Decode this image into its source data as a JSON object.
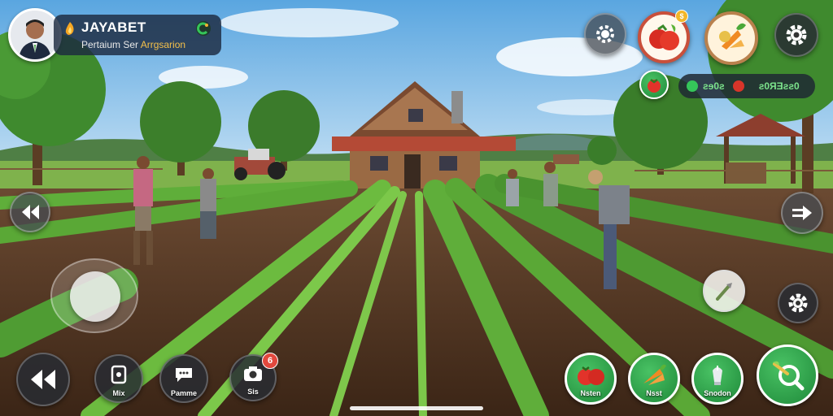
{
  "profile": {
    "title": "JAYABET",
    "subtitle_prefix": "Pertaium Ser ",
    "subtitle_accent": "Arrgsarion",
    "avatar_icon": "player-avatar",
    "brand_icon": "flame-icon",
    "badge_icon": "c-badge-icon"
  },
  "top_buttons": {
    "settings_gear_badge_icon": "gear-badge-icon",
    "tomato_basket_icon": "tomato-icon",
    "vegetables_icon": "vegetables-icon",
    "settings_icon": "gear-icon"
  },
  "stats": {
    "icon_a": "tomato-icon",
    "value_a": "ƨɘ0ƨ",
    "value_b": "ƨ0ЯƎƨƨ0",
    "icon_b": "green-leaf-icon"
  },
  "side_controls": {
    "left_arrow_icon": "double-arrow-left-icon",
    "right_arrow_icon": "arrow-right-icon",
    "tool_icon": "hoe-icon",
    "gear_icon": "gear-icon"
  },
  "bottom_left": [
    {
      "icon": "rewind-icon",
      "label": ""
    },
    {
      "icon": "phone-icon",
      "label": "Mix"
    },
    {
      "icon": "chat-icon",
      "label": "Pamme"
    },
    {
      "icon": "camera-icon",
      "label": "Sis",
      "badge": "6"
    }
  ],
  "bottom_right": [
    {
      "icon": "tomato-icon",
      "label": "Nsten"
    },
    {
      "icon": "carrot-icon",
      "label": "Nsst"
    },
    {
      "icon": "watering-icon",
      "label": "Snodon"
    },
    {
      "icon": "search-leaf-icon",
      "label": ""
    }
  ],
  "colors": {
    "accent_green": "#1f8a3a",
    "panel_dark": "#1c2a40",
    "notification_red": "#e2483d"
  }
}
